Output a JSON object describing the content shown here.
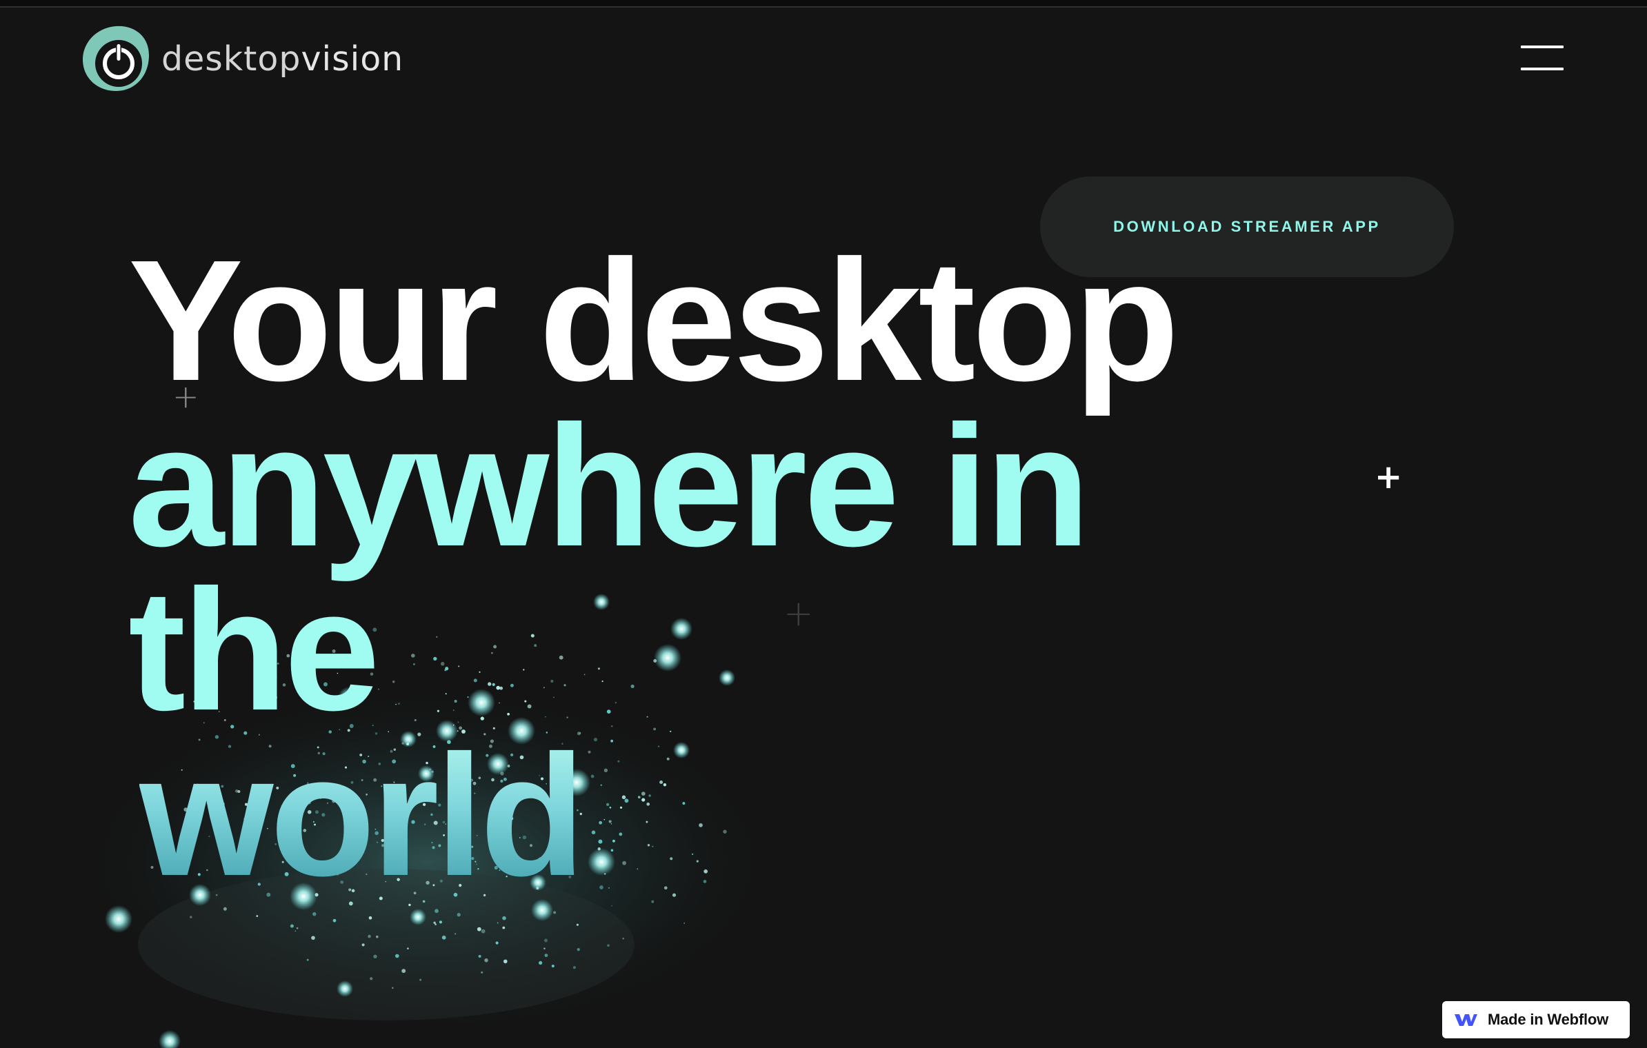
{
  "brand": {
    "name_light": "desktop",
    "name_bold": "vision",
    "logo_icon": "power-icon",
    "accent_color": "#8ff7ea",
    "logo_color": "#7fc7b7"
  },
  "nav": {
    "menu_icon": "hamburger-icon"
  },
  "hero": {
    "cta_label": "DOWNLOAD STREAMER APP",
    "headline_line1": "Your desktop",
    "headline_line2": "anywhere in",
    "headline_line3": "the",
    "headline_line4": "world",
    "headline_color_primary": "#ffffff",
    "headline_color_accent": "#a0fbf1"
  },
  "badge": {
    "label": "Made in Webflow",
    "icon": "webflow-icon"
  }
}
